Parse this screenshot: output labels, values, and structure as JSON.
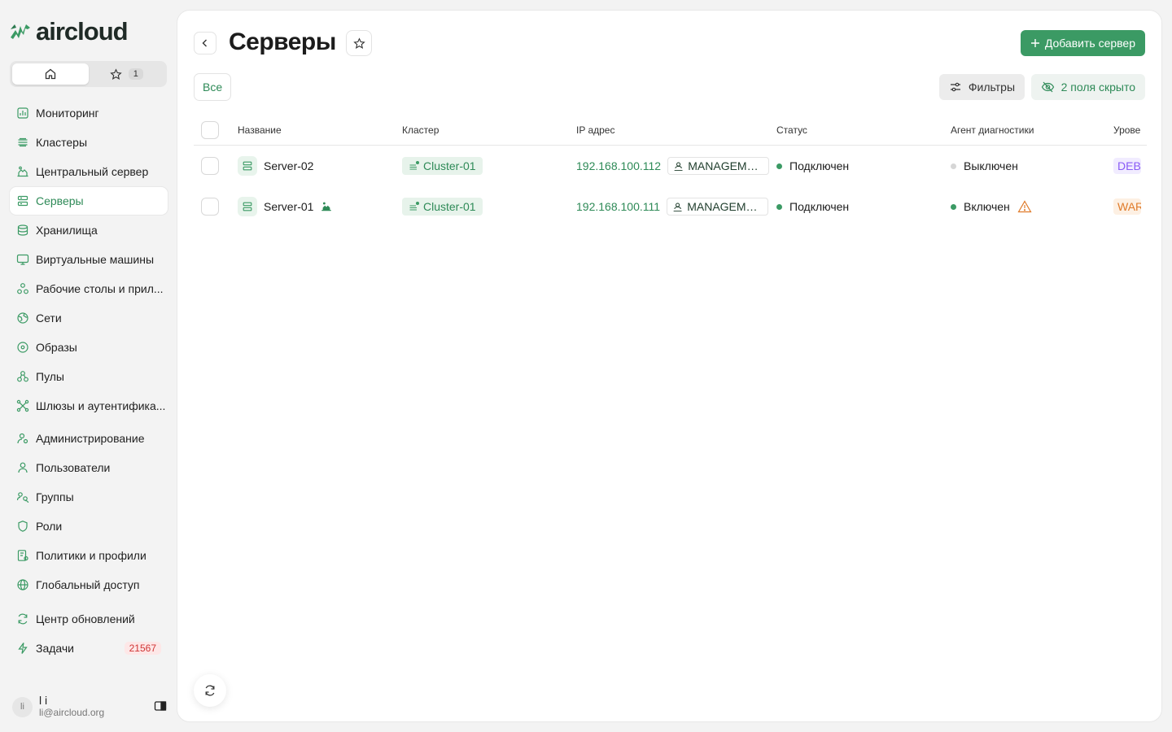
{
  "brand": {
    "name": "aircloud",
    "color": "#3b9a64"
  },
  "switcher": {
    "favorites_count": "1"
  },
  "nav": {
    "items": [
      {
        "label": "Мониторинг",
        "icon": "chart-icon"
      },
      {
        "label": "Кластеры",
        "icon": "layers-icon"
      },
      {
        "label": "Центральный сервер",
        "icon": "central-server-icon"
      },
      {
        "label": "Серверы",
        "icon": "server-icon",
        "active": true
      },
      {
        "label": "Хранилища",
        "icon": "database-icon"
      },
      {
        "label": "Виртуальные машины",
        "icon": "monitor-icon"
      },
      {
        "label": "Рабочие столы и прил...",
        "icon": "apps-icon"
      },
      {
        "label": "Сети",
        "icon": "globe-network-icon"
      },
      {
        "label": "Образы",
        "icon": "disc-icon"
      },
      {
        "label": "Пулы",
        "icon": "pools-icon"
      },
      {
        "label": "Шлюзы и аутентифика...",
        "icon": "gateway-icon"
      }
    ],
    "admin_items": [
      {
        "label": "Администрирование",
        "icon": "admin-icon"
      },
      {
        "label": "Пользователи",
        "icon": "user-icon"
      },
      {
        "label": "Группы",
        "icon": "group-icon"
      },
      {
        "label": "Роли",
        "icon": "shield-icon"
      },
      {
        "label": "Политики и профили",
        "icon": "policy-icon"
      },
      {
        "label": "Глобальный доступ",
        "icon": "globe-icon"
      }
    ],
    "updates_label": "Центр обновлений",
    "tasks_label": "Задачи",
    "tasks_count": "21567"
  },
  "user": {
    "initials": "li",
    "name": "l i",
    "email": "li@aircloud.org"
  },
  "header": {
    "title": "Серверы",
    "add_button": "Добавить сервер",
    "filter_all": "Все",
    "filters_button": "Фильтры",
    "hidden_fields_button": "2 поля скрыто"
  },
  "table": {
    "columns": [
      "Название",
      "Кластер",
      "IP адрес",
      "Статус",
      "Агент диагностики",
      "Урове"
    ],
    "rows": [
      {
        "name": "Server-02",
        "cluster": "Cluster-01",
        "ip": "192.168.100.112",
        "network": "MANAGEMEN...",
        "status": "Подключен",
        "agent": "Выключен",
        "agent_color": "#d6d6d6",
        "level": "DEBU",
        "level_color": "#8a5cf6",
        "level_bg": "#f1ecff"
      },
      {
        "name": "Server-01",
        "cluster": "Cluster-01",
        "ip": "192.168.100.111",
        "network": "MANAGEMEN...",
        "status": "Подключен",
        "agent": "Включен",
        "agent_color": "#3b9a64",
        "level": "WAR",
        "level_color": "#e07b2a",
        "level_bg": "#fdf0e3"
      }
    ]
  }
}
